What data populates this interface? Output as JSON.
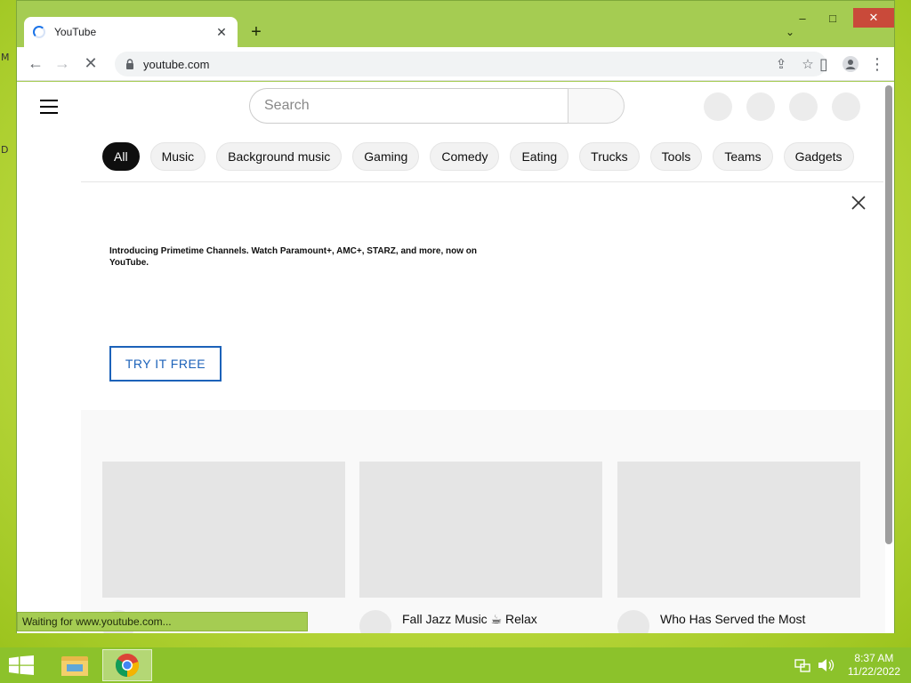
{
  "desktop": {
    "edge_labels": [
      "M",
      "D"
    ]
  },
  "window": {
    "controls": {
      "minimize": "–",
      "maximize": "□",
      "close": "✕"
    },
    "tab": {
      "title": "YouTube",
      "close": "✕"
    },
    "new_tab": "+",
    "tab_search": "⌄",
    "toolbar": {
      "back": "←",
      "forward": "→",
      "stop": "✕",
      "url": "youtube.com",
      "share": "⇪",
      "bookmark": "☆",
      "side_panel": "▯",
      "menu": "⋮"
    },
    "status_text": "Waiting for www.youtube.com..."
  },
  "youtube": {
    "search_placeholder": "Search",
    "chips": [
      "All",
      "Music",
      "Background music",
      "Gaming",
      "Comedy",
      "Eating",
      "Trucks",
      "Tools",
      "Teams",
      "Gadgets"
    ],
    "active_chip": "All",
    "promo": {
      "text": "Introducing Primetime Channels. Watch Paramount+, AMC+, STARZ, and more, now on YouTube.",
      "button": "TRY IT FREE"
    },
    "videos": [
      {
        "title": ""
      },
      {
        "title": "Fall Jazz Music ☕ Relax"
      },
      {
        "title": "Who Has Served the Most"
      }
    ]
  },
  "taskbar": {
    "time": "8:37 AM",
    "date": "11/22/2022"
  },
  "colors": {
    "desktop_green": "#b6d63c",
    "window_frame": "#a5cc52",
    "taskbar": "#8cc22b",
    "try_button_blue": "#1c62b9",
    "close_red": "#c94a3a"
  }
}
